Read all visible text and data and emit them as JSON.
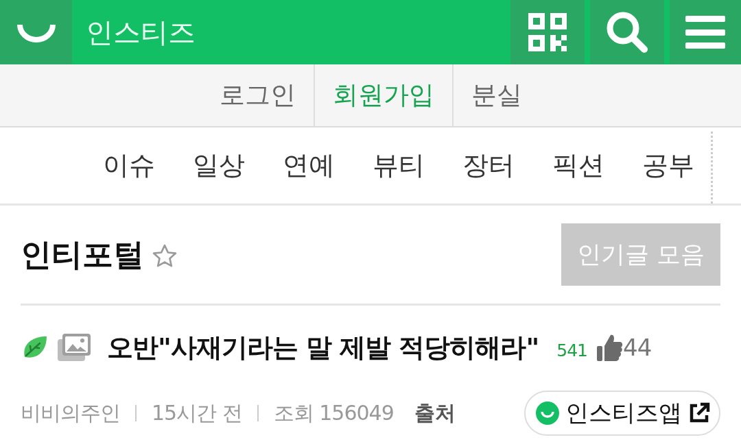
{
  "header": {
    "site_name": "인스티즈"
  },
  "account_nav": [
    {
      "label": "로그인",
      "selected": false
    },
    {
      "label": "회원가입",
      "selected": true
    },
    {
      "label": "분실",
      "selected": false
    }
  ],
  "categories": [
    "이슈",
    "일상",
    "연예",
    "뷰티",
    "장터",
    "픽션",
    "공부"
  ],
  "board": {
    "title": "인티포털",
    "favorite": false,
    "popular_button": "인기글 모음"
  },
  "post": {
    "title": "오반\"사재기라는 말 제발 적당히해라\"",
    "comments": "541",
    "likes": "44",
    "author": "비비의주인",
    "time": "15시간 전",
    "views": "조회 156049",
    "source": "출처",
    "app_button": "인스티즈앱"
  }
}
